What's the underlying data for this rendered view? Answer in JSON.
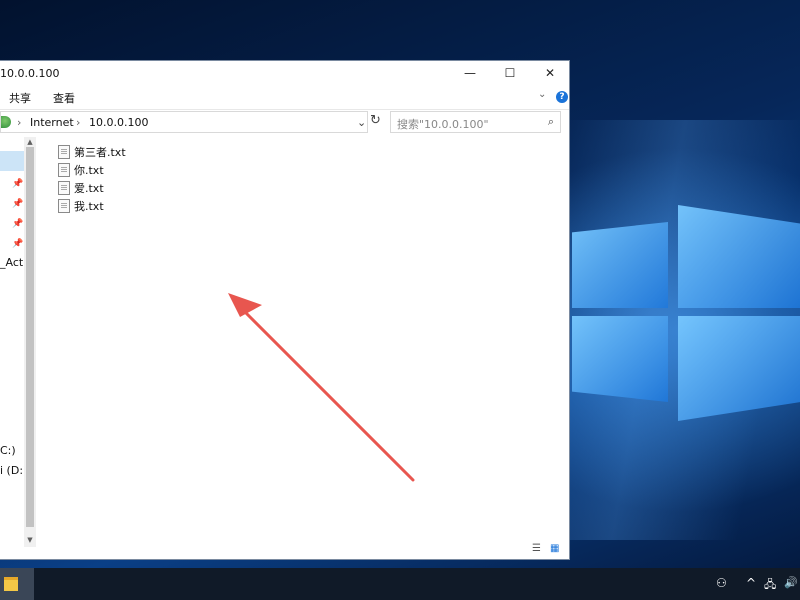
{
  "window": {
    "title": "10.0.0.100",
    "controls": {
      "minimize": "—",
      "maximize": "☐",
      "close": "✕"
    }
  },
  "ribbon": {
    "tabs": [
      "共享",
      "查看"
    ],
    "expand": "⌄",
    "help": "?"
  },
  "address": {
    "path": [
      "Internet",
      "10.0.0.100"
    ],
    "separator": "›",
    "dropdown": "⌄",
    "refresh": "↻"
  },
  "search": {
    "placeholder": "搜索\"10.0.0.100\"",
    "icon": "⌕"
  },
  "nav_pane": {
    "pins": [
      "📌",
      "📌",
      "📌",
      "📌"
    ],
    "items": [
      "_Acti",
      "C:)",
      "i (D:)"
    ]
  },
  "files": [
    {
      "name": "第三者.txt"
    },
    {
      "name": "你.txt"
    },
    {
      "name": "爱.txt"
    },
    {
      "name": "我.txt"
    }
  ],
  "view_buttons": {
    "details": "☰",
    "large_icons": "▦"
  },
  "tray": {
    "people": "⚇",
    "chevron": "^",
    "network": "🖧",
    "volume": "🔊"
  },
  "colors": {
    "selection": "#cce4f7",
    "annotation_arrow": "#e8564f",
    "taskbar": "#101a28"
  }
}
